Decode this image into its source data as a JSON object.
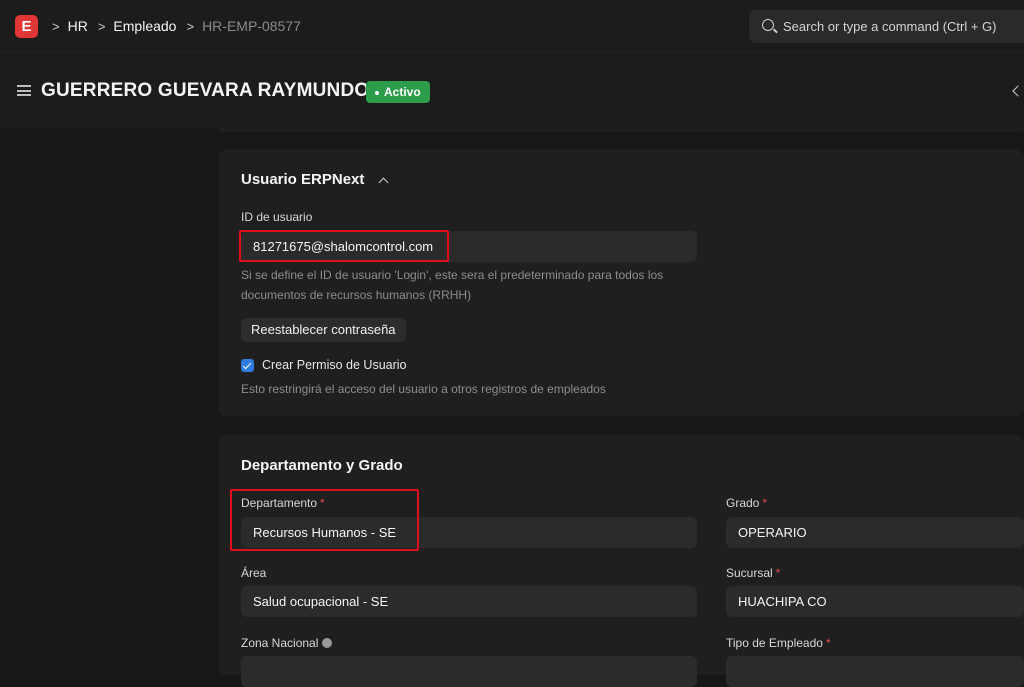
{
  "topbar": {
    "logo_letter": "E",
    "breadcrumbs": [
      "HR",
      "Empleado",
      "HR-EMP-08577"
    ],
    "search_placeholder": "Search or type a command (Ctrl + G)"
  },
  "header": {
    "title": "GUERRERO GUEVARA RAYMUNDO",
    "status": "Activo"
  },
  "user_section": {
    "title": "Usuario ERPNext",
    "user_id_label": "ID de usuario",
    "user_id_value": "81271675@shalomcontrol.com",
    "user_id_help_line1": "Si se define el ID de usuario 'Login', este sera el predeterminado para todos los",
    "user_id_help_line2": "documentos de recursos humanos (RRHH)",
    "reset_password_label": "Reestablecer contraseña",
    "create_permission_label": "Crear Permiso de Usuario",
    "create_permission_checked": true,
    "create_permission_help": "Esto restringirá el acceso del usuario a otros registros de empleados"
  },
  "department_section": {
    "title": "Departamento y Grado",
    "department_label": "Departamento",
    "department_value": "Recursos Humanos - SE",
    "grade_label": "Grado",
    "grade_value": "OPERARIO",
    "area_label": "Área",
    "area_value": "Salud ocupacional - SE",
    "branch_label": "Sucursal",
    "branch_value": "HUACHIPA CO",
    "zone_label": "Zona Nacional",
    "employee_type_label": "Tipo de Empleado"
  },
  "colors": {
    "accent_status": "#2d9c4a",
    "highlight": "#e0101a",
    "checkbox": "#2f7ce0",
    "logo": "#e03636"
  }
}
